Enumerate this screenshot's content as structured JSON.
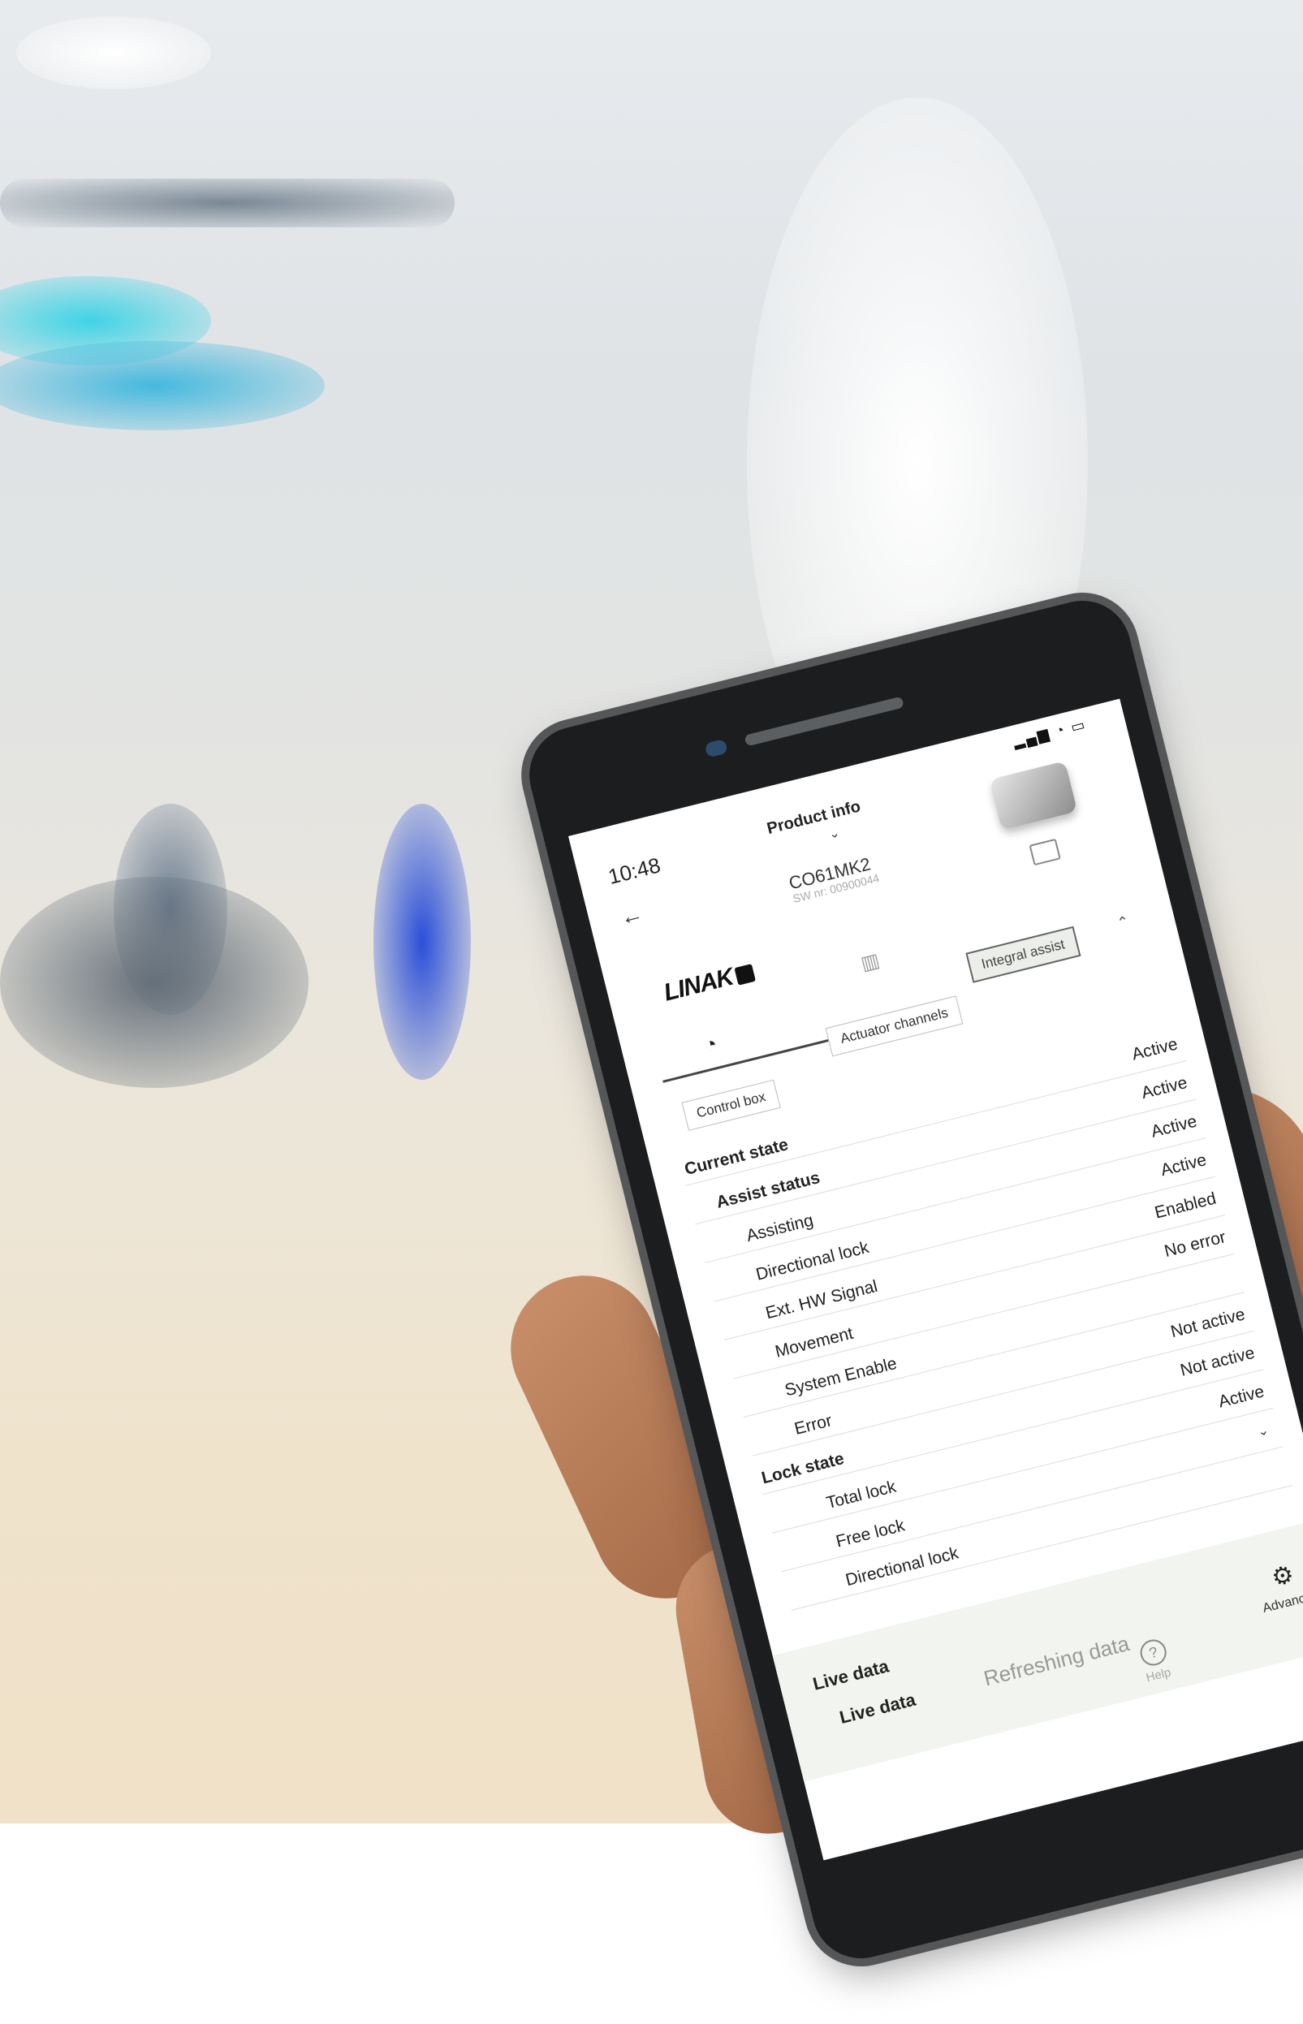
{
  "status_bar": {
    "time": "10:48"
  },
  "header": {
    "title": "Product info",
    "model": "CO61MK2",
    "sw": "SW nr: 00900044",
    "brand": "LINAK"
  },
  "tabs": {
    "control_box": "Control box",
    "actuator_channels": "Actuator channels",
    "integral_assist": "Integral assist"
  },
  "rows": [
    {
      "label": "Current state",
      "value": "Active"
    },
    {
      "label": "Assist status",
      "value": "Active"
    },
    {
      "label": "Assisting",
      "value": "Active"
    },
    {
      "label": "Directional lock",
      "value": "Active"
    },
    {
      "label": "Ext. HW Signal",
      "value": "Enabled"
    },
    {
      "label": "Movement",
      "value": "No error"
    },
    {
      "label": "System Enable",
      "value": ""
    },
    {
      "label": "Error",
      "value": "Not active"
    },
    {
      "label": "Lock state",
      "value": "Not active"
    },
    {
      "label": "Total lock",
      "value": "Active"
    },
    {
      "label": "Free lock",
      "value": ""
    },
    {
      "label": "Directional lock",
      "value": ""
    }
  ],
  "live": {
    "section_title": "Live data",
    "label": "Live data",
    "status": "Refreshing data"
  },
  "bottom_nav": {
    "help": "Help",
    "advanced": "Advanced"
  },
  "icons": {
    "back": "arrow-left-icon",
    "device_finder": "device-search-icon",
    "tab_gauge": "gauge-icon",
    "tab_chart": "chart-icon",
    "advanced": "gear-search-icon",
    "help": "question-icon"
  }
}
